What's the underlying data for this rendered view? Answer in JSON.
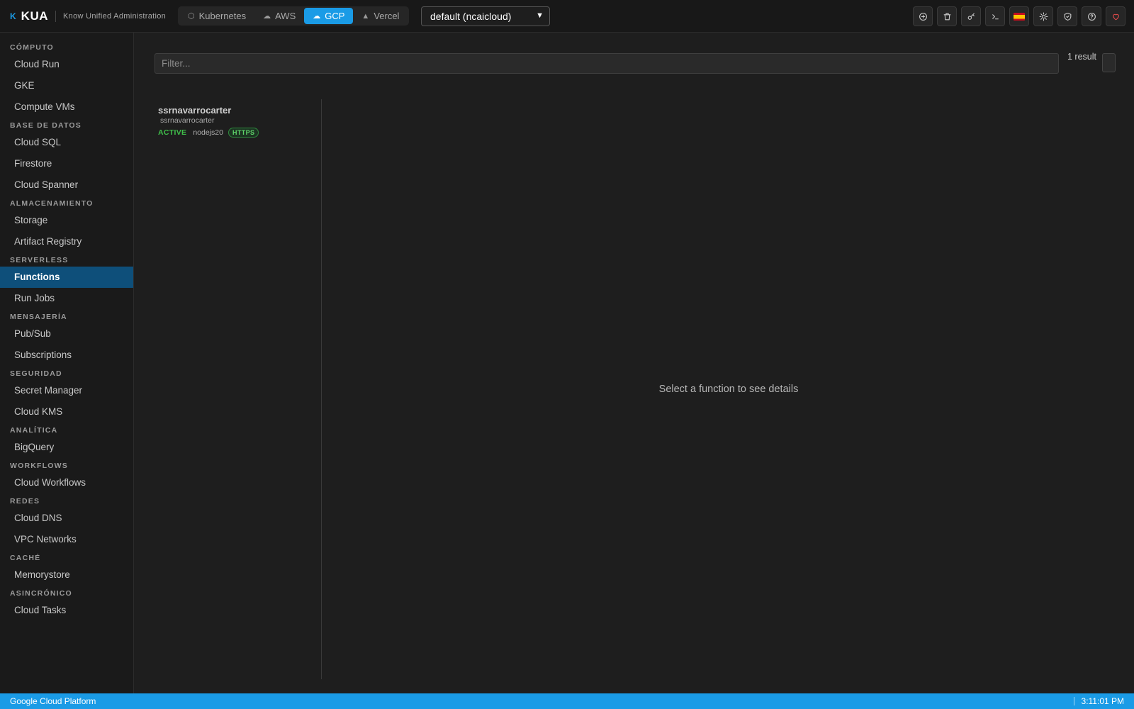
{
  "app": {
    "logo_mark": "K",
    "name": "KUA",
    "subtitle": "Know Unified Administration"
  },
  "providers": [
    {
      "label": "Kubernetes",
      "icon": "cube-icon",
      "active": false
    },
    {
      "label": "AWS",
      "icon": "cloud-icon",
      "active": false
    },
    {
      "label": "GCP",
      "icon": "cloud-icon",
      "active": true
    },
    {
      "label": "Vercel",
      "icon": "triangle-icon",
      "active": false
    }
  ],
  "project": {
    "selected": "default (ncaicloud)"
  },
  "toolbar_icons": [
    "plus-circle-icon",
    "trash-icon",
    "key-icon",
    "terminal-icon",
    "spain-flag-icon",
    "sun-icon",
    "shield-icon",
    "help-icon",
    "heart-icon"
  ],
  "sidebar": {
    "sections": [
      {
        "title": "CÓMPUTO",
        "items": [
          {
            "label": "Cloud Run"
          },
          {
            "label": "GKE"
          },
          {
            "label": "Compute VMs"
          }
        ]
      },
      {
        "title": "BASE DE DATOS",
        "items": [
          {
            "label": "Cloud SQL"
          },
          {
            "label": "Firestore"
          },
          {
            "label": "Cloud Spanner"
          }
        ]
      },
      {
        "title": "ALMACENAMIENTO",
        "items": [
          {
            "label": "Storage"
          },
          {
            "label": "Artifact Registry"
          }
        ]
      },
      {
        "title": "SERVERLESS",
        "items": [
          {
            "label": "Functions",
            "active": true
          },
          {
            "label": "Run Jobs"
          }
        ]
      },
      {
        "title": "MENSAJERÍA",
        "items": [
          {
            "label": "Pub/Sub"
          },
          {
            "label": "Subscriptions"
          }
        ]
      },
      {
        "title": "SEGURIDAD",
        "items": [
          {
            "label": "Secret Manager"
          },
          {
            "label": "Cloud KMS"
          }
        ]
      },
      {
        "title": "ANALÍTICA",
        "items": [
          {
            "label": "BigQuery"
          }
        ]
      },
      {
        "title": "WORKFLOWS",
        "items": [
          {
            "label": "Cloud Workflows"
          }
        ]
      },
      {
        "title": "REDES",
        "items": [
          {
            "label": "Cloud DNS"
          },
          {
            "label": "VPC Networks"
          }
        ]
      },
      {
        "title": "CACHÉ",
        "items": [
          {
            "label": "Memorystore"
          }
        ]
      },
      {
        "title": "ASINCRÓNICO",
        "items": [
          {
            "label": "Cloud Tasks"
          }
        ]
      }
    ]
  },
  "main": {
    "filter": {
      "placeholder": "Filter...",
      "value": ""
    },
    "result_count": "1 result",
    "functions": [
      {
        "name": "ssrnavarrocarter",
        "sub": "ssrnavarrocarter",
        "status": "ACTIVE",
        "runtime": "nodejs20",
        "trigger": "HTTPS"
      }
    ],
    "empty_detail": "Select a function to see details"
  },
  "statusbar": {
    "left": "Google Cloud Platform",
    "time": "3:11:01 PM"
  }
}
